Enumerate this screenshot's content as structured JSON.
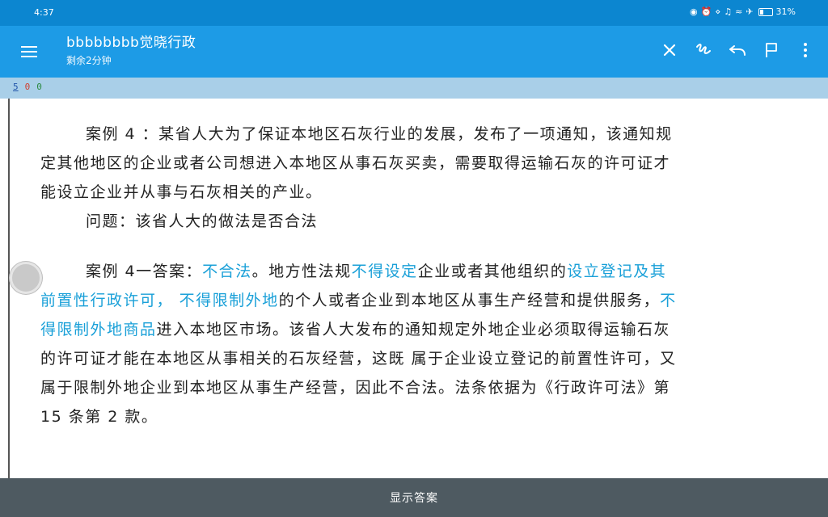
{
  "status": {
    "time": "4:37",
    "battery": "31%"
  },
  "appbar": {
    "title": "bbbbbbbb觉晓行政",
    "subtitle": "剩余2分钟"
  },
  "subbar": {
    "mark_a": "5",
    "mark_b": "0",
    "mark_c": "0"
  },
  "document": {
    "q_label": "案例 4 ：",
    "q_text": "某省人大为了保证本地区石灰行业的发展，发布了一项通知，该通知规定其他地区的企业或者公司想进入本地区从事石灰买卖，需要取得运输石灰的许可证才能设立企业并从事与石灰相关的产业。",
    "question": "问题：该省人大的做法是否合法",
    "ans_label": "案例 4一答案：",
    "ans_hl_1": "不合法",
    "ans_t_1": "。地方性法规",
    "ans_hl_2": "不得设定",
    "ans_t_2": "企业或者其他组织的",
    "ans_hl_3": "设立登记及其前置性行政许可，",
    "ans_t_3": " ",
    "ans_hl_4": "不得限制外地",
    "ans_t_4": "的个人或者企业到本地区从事生产经营和提供服务，",
    "ans_hl_5": "不得限制外地商品",
    "ans_t_5": "进入本地区市场。该省人大发布的通知规定外地企业必须取得运输石灰的许可证才能在本地区从事相关的石灰经营，这既 属于企业设立登记的前置性许可，又属于限制外地企业到本地区从事生产经营，因此不合法。法条依据为《行政许可法》第 15 条第 2 款。"
  },
  "bottom": {
    "show_answer": "显示答案"
  },
  "colors": {
    "status_bg": "#0c86d0",
    "appbar_bg": "#1d9be6",
    "highlight": "#1aa0d8",
    "bottom_bg": "#4e5a61"
  }
}
